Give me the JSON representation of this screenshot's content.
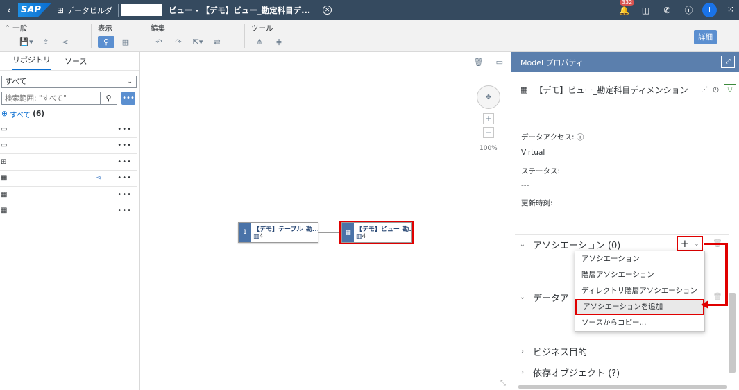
{
  "shell": {
    "logo": "SAP",
    "app_name": "データビルダ",
    "title": "ビュー - 【デモ】ビュー_勘定科目デ...",
    "notification_count": "332",
    "avatar": "I"
  },
  "toolbar": {
    "groups": [
      {
        "label": "一般"
      },
      {
        "label": "表示"
      },
      {
        "label": "編集"
      },
      {
        "label": "ツール"
      }
    ],
    "detail_label": "詳細"
  },
  "left": {
    "tabs": [
      "リポジトリ",
      "ソース"
    ],
    "filter_value": "すべて",
    "search_placeholder": "検索範囲: \"すべて\"",
    "all_label": "すべて",
    "all_count": "(6)"
  },
  "canvas": {
    "zoom": "100%",
    "node1": {
      "index": "1",
      "name": "【デモ】テーブル_勘...",
      "count": "4"
    },
    "node2": {
      "name": "【デモ】ビュー_勘...",
      "count": "4"
    }
  },
  "right": {
    "header": "Model プロパティ",
    "title": "【デモ】ビュー_勘定科目ディメンション",
    "data_access_label": "データアクセス:",
    "data_access_value": "Virtual",
    "status_label": "ステータス:",
    "status_value": "---",
    "updated_label": "更新時刻:",
    "sections": {
      "associations": "アソシエーション (0)",
      "data_partial": "データア",
      "business": "ビジネス目的",
      "dependent": "依存オブジェクト (?)"
    },
    "menu": [
      "アソシエーション",
      "階層アソシエーション",
      "ディレクトリ階層アソシエーション",
      "アソシエーションを追加",
      "ソースからコピー..."
    ]
  }
}
